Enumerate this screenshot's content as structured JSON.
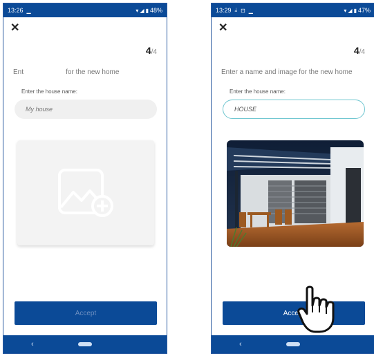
{
  "screens": [
    {
      "status": {
        "time": "13:26",
        "battery": "48%"
      },
      "step": {
        "current": "4",
        "total": "/4"
      },
      "instruction": "Ent                      for the new home",
      "field_label": "Enter the house name:",
      "name_input": {
        "value": "",
        "placeholder": "My house"
      },
      "accept_label": "Accept",
      "accept_enabled": false
    },
    {
      "status": {
        "time": "13:29",
        "battery": "47%"
      },
      "step": {
        "current": "4",
        "total": "/4"
      },
      "instruction": "Enter a name and image for the new home",
      "field_label": "Enter the house name:",
      "name_input": {
        "value": "HOUSE",
        "placeholder": "My house"
      },
      "accept_label": "Accept",
      "accept_enabled": true
    }
  ],
  "colors": {
    "primary": "#0b4a97",
    "input_focus_border": "#6fc6d0",
    "input_bg": "#f0f0f0"
  },
  "icons": [
    "close-icon",
    "add-image-icon",
    "back-icon",
    "home-icon",
    "wifi-icon",
    "signal-icon",
    "battery-icon",
    "download-icon",
    "lock-icon",
    "pointer-hand-icon"
  ]
}
